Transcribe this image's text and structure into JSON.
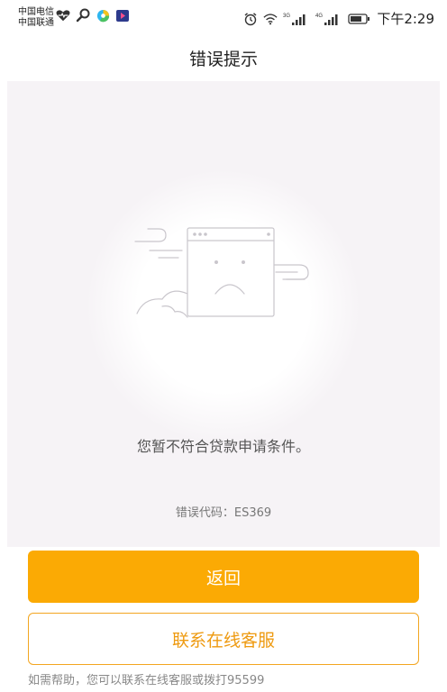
{
  "status_bar": {
    "carrier_1": "中国电信",
    "carrier_2": "中国联通",
    "network_3g": "3G",
    "network_4g": "4G",
    "time": "下午2:29"
  },
  "header": {
    "title": "错误提示"
  },
  "main": {
    "message": "您暂不符合贷款申请条件。",
    "error_code": "错误代码：ES369"
  },
  "actions": {
    "back_label": "返回",
    "contact_label": "联系在线客服"
  },
  "footer": {
    "help_text": "如需帮助，您可以联系在线客服或拨打95599"
  },
  "colors": {
    "primary": "#fbaa04",
    "outline": "#f3a620",
    "background": "#f6f3f6"
  },
  "icons": [
    "heart-rate-icon",
    "search-icon",
    "browser-icon",
    "video-icon",
    "alarm-icon",
    "wifi-icon",
    "signal-icon",
    "battery-icon",
    "sad-browser-illustration"
  ]
}
